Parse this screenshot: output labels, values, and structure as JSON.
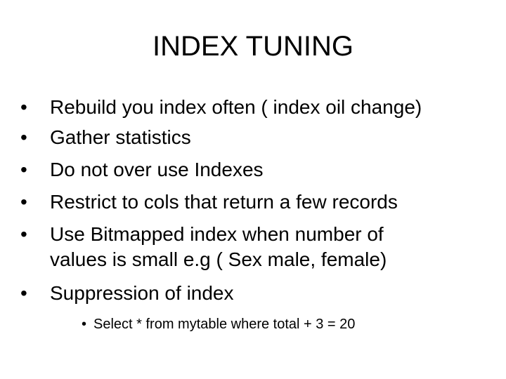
{
  "slide": {
    "title": "INDEX TUNING",
    "bullet_glyph": "•",
    "bullets": [
      {
        "text": "Rebuild you index often ( index oil change)"
      },
      {
        "text": "Gather statistics"
      },
      {
        "text": "Do not over use Indexes"
      },
      {
        "text": "Restrict to cols that return a few records"
      },
      {
        "text": "Use Bitmapped index when number of",
        "continuation": "values is small e.g ( Sex male, female)"
      },
      {
        "text": "Suppression of index"
      }
    ],
    "sub_bullets": [
      {
        "text": "Select * from mytable where total + 3 = 20"
      }
    ]
  }
}
